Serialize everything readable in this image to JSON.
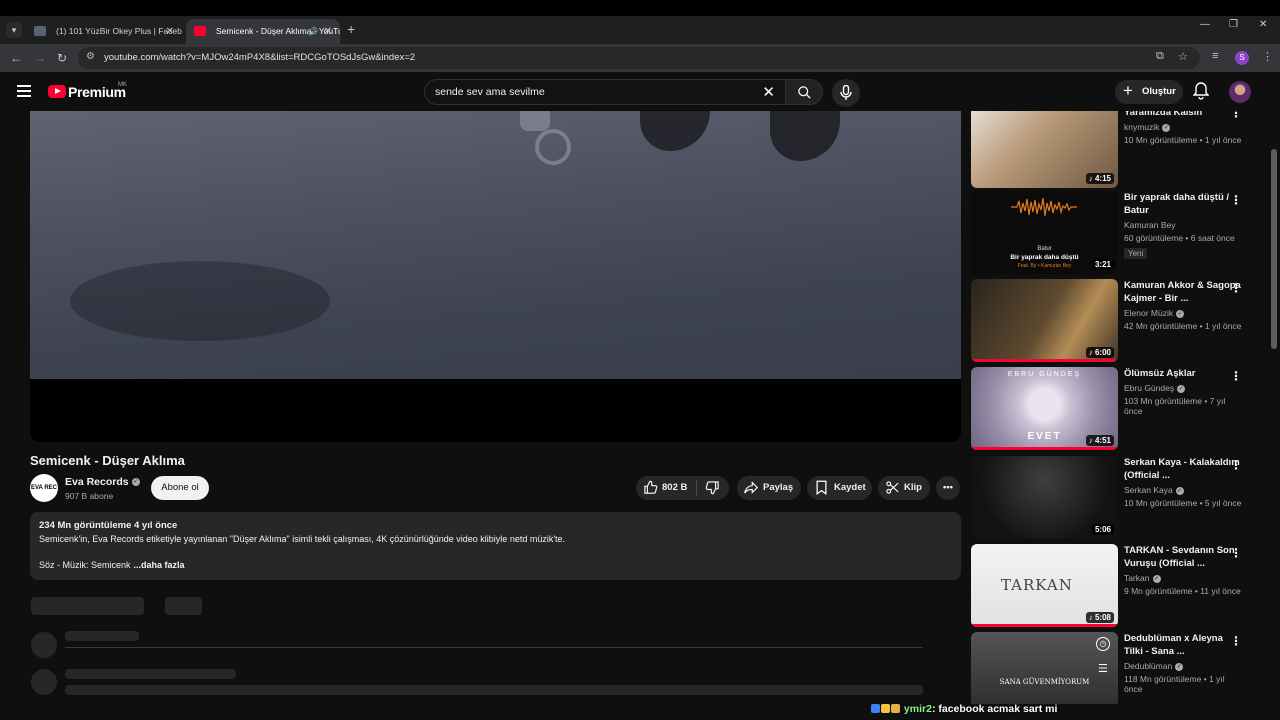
{
  "browser": {
    "tabs": [
      {
        "title": "(1) 101 YüzBir Okey Plus | Facebook",
        "active": false
      },
      {
        "title": "Semicenk - Düşer Aklıma - YouTube",
        "active": true
      }
    ],
    "url": "youtube.com/watch?v=MJOw24mP4X8&list=RDCGoTOSdJsGw&index=2",
    "profile_initial": "S"
  },
  "youtube": {
    "logo_text": "Premium",
    "logo_region": "MK",
    "search_value": "sende sev ama sevilme",
    "create_label": "Oluştur"
  },
  "video": {
    "title": "Semicenk - Düşer Aklıma",
    "channel": {
      "name": "Eva Records",
      "subscribers": "907 B abone",
      "logo_text": "EVA REC"
    },
    "subscribe_label": "Abone ol",
    "likes": "802 B",
    "share_label": "Paylaş",
    "save_label": "Kaydet",
    "clip_label": "Klip",
    "description": {
      "meta": "234 Mn görüntüleme  4 yıl önce",
      "line1": "Semicenk'in, Eva Records etiketiyle yayınlanan \"Düşer Aklıma\" isimli tekli çalışması, 4K çözünürlüğünde video klibiyle netd müzik'te.",
      "line2": "Söz - Müzik: Semicenk",
      "more": "...daha fazla"
    }
  },
  "sidebar": [
    {
      "title": "Yaramızda Kalsın",
      "channel": "knymuzik",
      "verified": true,
      "views": "10 Mn görüntüleme • 1 yıl önce",
      "duration": "4:15",
      "new": ""
    },
    {
      "title": "Bir yaprak daha düştü / Batur",
      "channel": "Kamuran Bey",
      "verified": false,
      "views": "60 görüntüleme • 6 saat önce",
      "duration": "3:21",
      "new": "Yeni",
      "thumb_text1": "Batur",
      "thumb_text2": "Bir yaprak daha düştü",
      "thumb_text3": "Feat. By • Kamuran Bey"
    },
    {
      "title": "Kamuran Akkor & Sagopa Kajmer - Bir ...",
      "channel": "Elenor Müzik",
      "verified": true,
      "views": "42 Mn görüntüleme • 1 yıl önce",
      "duration": "6:00",
      "new": ""
    },
    {
      "title": "Ölümsüz Aşklar",
      "channel": "Ebru Gündeş",
      "verified": true,
      "views": "103 Mn görüntüleme • 7 yıl önce",
      "duration": "4:51",
      "new": "",
      "thumb_text1": "EBRU GÜNDEŞ",
      "thumb_text2": "EVET"
    },
    {
      "title": "Serkan Kaya - Kalakaldım (Official ...",
      "channel": "Serkan Kaya",
      "verified": true,
      "views": "10 Mn görüntüleme • 5 yıl önce",
      "duration": "5:06",
      "new": ""
    },
    {
      "title": "TARKAN - Sevdanın Son Vuruşu (Official ...",
      "channel": "Tarkan",
      "verified": true,
      "views": "9 Mn görüntüleme • 11 yıl önce",
      "duration": "5:08",
      "new": "",
      "thumb_text1": "TARKAN"
    },
    {
      "title": "Dedublüman x Aleyna Tilki - Sana ...",
      "channel": "Dedublüman",
      "verified": true,
      "views": "118 Mn görüntüleme • 1 yıl önce",
      "duration": "",
      "new": "",
      "thumb_text1": "SANA GÜVENMİYORUM"
    }
  ],
  "chat": {
    "user": "ymir2",
    "message": ": facebook acmak sart mi"
  }
}
